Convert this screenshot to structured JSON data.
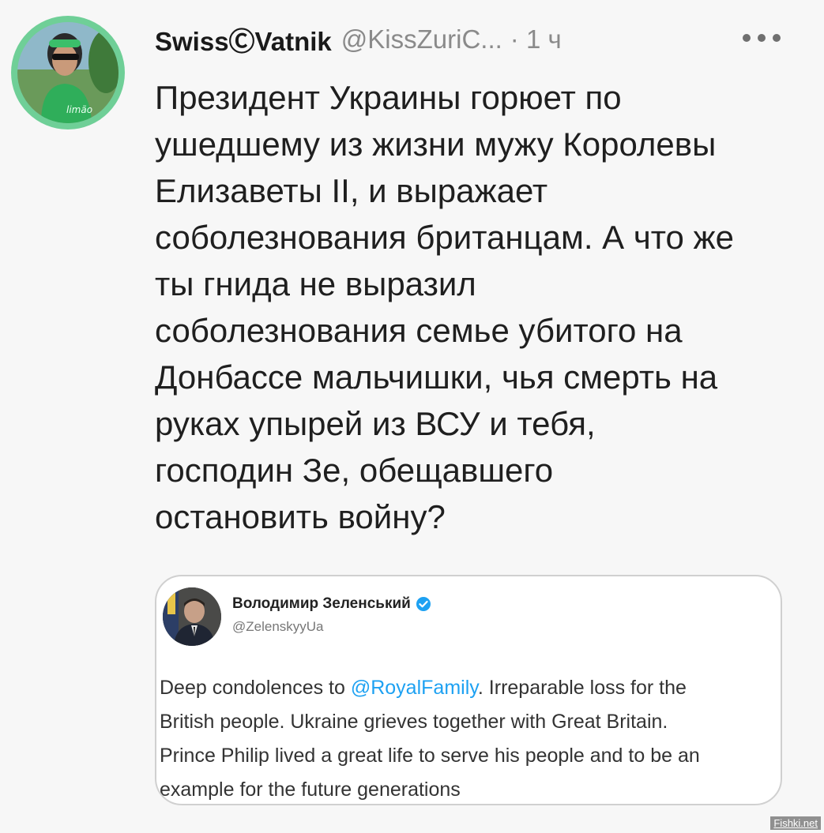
{
  "tweet": {
    "author_name": "SwissⒸVatnik",
    "author_handle": "@KissZuriC...",
    "time": "· 1 ч",
    "more_icon": "more-horizontal-icon",
    "text_lines": [
      "Президент Украины горюет по",
      "ушедшему из жизни мужу Королевы",
      "Елизаветы II, и выражает",
      "соболезнования британцам. А что же",
      "ты гнида не выразил",
      "соболезнования семье убитого на",
      "Донбассе мальчишки, чья смерть на",
      "руках упырей из ВСУ и тебя,",
      "господин Зе, обещавшего",
      "остановить войну?"
    ]
  },
  "quoted": {
    "name": "Володимир Зеленський",
    "handle": "@ZelenskyyUa",
    "verified_icon": "verified-badge-icon",
    "line1_before": "Deep condolences to ",
    "line1_mention": "@RoyalFamily",
    "line1_after": ". Irreparable loss for the",
    "line2": "British people. Ukraine grieves together with Great Britain.",
    "line3": "Prince Philip lived a great life to serve his people and to be an",
    "line4": "example for the future generations"
  },
  "watermark": "Fishki.net",
  "colors": {
    "avatar_ring": "#6fcf97",
    "mention": "#1da1f2",
    "verified": "#1da1f2",
    "background": "#f7f7f7"
  }
}
